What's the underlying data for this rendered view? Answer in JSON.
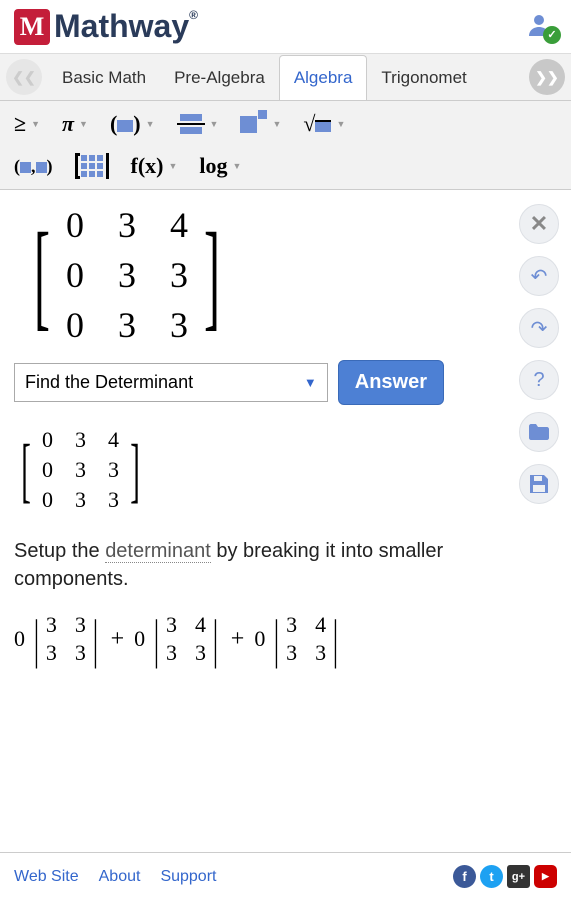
{
  "logo": {
    "icon": "M",
    "text": "Mathway"
  },
  "tabs": {
    "items": [
      "Basic Math",
      "Pre-Algebra",
      "Algebra",
      "Trigonomet"
    ],
    "active": 2
  },
  "toolbar": {
    "row1": [
      "≥",
      "π",
      "paren",
      "frac",
      "exp",
      "sqrt"
    ],
    "row2_fx": "f(x)",
    "row2_log": "log"
  },
  "matrix_main": [
    [
      "0",
      "3",
      "4"
    ],
    [
      "0",
      "3",
      "3"
    ],
    [
      "0",
      "3",
      "3"
    ]
  ],
  "action": {
    "select": "Find the Determinant",
    "button": "Answer"
  },
  "side_actions": [
    "close",
    "undo",
    "redo",
    "help",
    "folder",
    "save"
  ],
  "matrix_small": [
    [
      "0",
      "3",
      "4"
    ],
    [
      "0",
      "3",
      "3"
    ],
    [
      "0",
      "3",
      "3"
    ]
  ],
  "explain": {
    "pre": "Setup the ",
    "term": "determinant",
    "post": " by breaking it into smaller components."
  },
  "cofactors": [
    {
      "c": "0",
      "m": [
        [
          "3",
          "3"
        ],
        [
          "3",
          "3"
        ]
      ]
    },
    {
      "c": "0",
      "m": [
        [
          "3",
          "4"
        ],
        [
          "3",
          "3"
        ]
      ]
    },
    {
      "c": "0",
      "m": [
        [
          "3",
          "4"
        ],
        [
          "3",
          "3"
        ]
      ]
    }
  ],
  "footer": {
    "links": [
      "Web Site",
      "About",
      "Support"
    ],
    "social": [
      "f",
      "t",
      "g+",
      "▶"
    ]
  }
}
